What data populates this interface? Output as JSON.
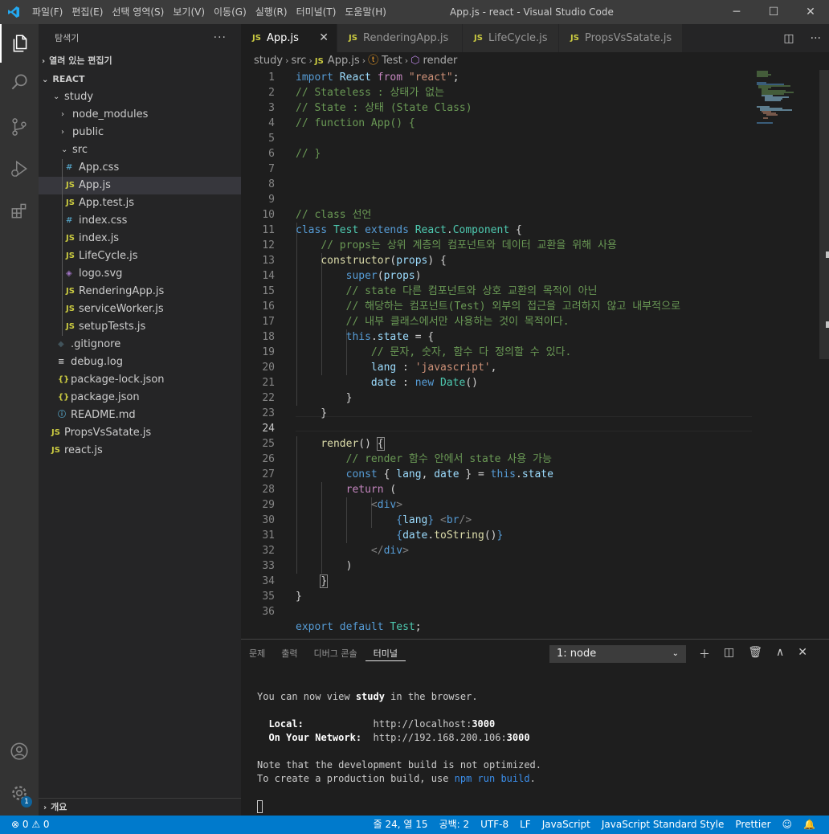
{
  "titlebar": {
    "menu": [
      "파일(F)",
      "편집(E)",
      "선택 영역(S)",
      "보기(V)",
      "이동(G)",
      "실행(R)",
      "터미널(T)",
      "도움말(H)"
    ],
    "title": "App.js - react - Visual Studio Code",
    "minimize": "─",
    "maximize": "☐",
    "close": "✕"
  },
  "sidebar": {
    "title": "탐색기",
    "more": "···",
    "open_editors": "열려 있는 편집기",
    "root": "REACT",
    "outline": "개요",
    "tree": [
      {
        "label": "study",
        "kind": "folder",
        "icon": "",
        "chev": "⌄"
      },
      {
        "label": "node_modules",
        "kind": "folder",
        "icon": "",
        "chev": "›"
      },
      {
        "label": "public",
        "kind": "folder",
        "icon": "",
        "chev": "›"
      },
      {
        "label": "src",
        "kind": "folder",
        "icon": "",
        "chev": "⌄"
      },
      {
        "label": "App.css",
        "kind": "css",
        "icon": "#"
      },
      {
        "label": "App.js",
        "kind": "js",
        "icon": "JS"
      },
      {
        "label": "App.test.js",
        "kind": "js",
        "icon": "JS"
      },
      {
        "label": "index.css",
        "kind": "css",
        "icon": "#"
      },
      {
        "label": "index.js",
        "kind": "js",
        "icon": "JS"
      },
      {
        "label": "LifeCycle.js",
        "kind": "js",
        "icon": "JS"
      },
      {
        "label": "logo.svg",
        "kind": "svg",
        "icon": "◈"
      },
      {
        "label": "RenderingApp.js",
        "kind": "js",
        "icon": "JS"
      },
      {
        "label": "serviceWorker.js",
        "kind": "js",
        "icon": "JS"
      },
      {
        "label": "setupTests.js",
        "kind": "js",
        "icon": "JS"
      },
      {
        "label": ".gitignore",
        "kind": "git",
        "icon": "◆"
      },
      {
        "label": "debug.log",
        "kind": "log",
        "icon": "≡"
      },
      {
        "label": "package-lock.json",
        "kind": "json",
        "icon": "{}"
      },
      {
        "label": "package.json",
        "kind": "json",
        "icon": "{}"
      },
      {
        "label": "README.md",
        "kind": "info",
        "icon": "ⓘ"
      },
      {
        "label": "PropsVsSatate.js",
        "kind": "js",
        "icon": "JS"
      },
      {
        "label": "react.js",
        "kind": "js",
        "icon": "JS"
      }
    ]
  },
  "tabs": [
    {
      "label": "App.js",
      "icon": "JS",
      "close": "✕"
    },
    {
      "label": "RenderingApp.js",
      "icon": "JS"
    },
    {
      "label": "LifeCycle.js",
      "icon": "JS"
    },
    {
      "label": "PropsVsSatate.js",
      "icon": "JS"
    }
  ],
  "breadcrumb": {
    "items": [
      "study",
      "src",
      "App.js",
      "Test",
      "render"
    ],
    "sep": "›",
    "js": "JS"
  },
  "editor": {
    "line_numbers": [
      "1",
      "2",
      "3",
      "4",
      "5",
      "6",
      "7",
      "8",
      "9",
      "10",
      "11",
      "12",
      "13",
      "14",
      "15",
      "16",
      "17",
      "18",
      "19",
      "20",
      "21",
      "22",
      "23",
      "24",
      "25",
      "26",
      "27",
      "28",
      "29",
      "30",
      "31",
      "32",
      "33",
      "34",
      "35",
      "36"
    ]
  },
  "panel": {
    "tabs": [
      "문제",
      "출력",
      "디버그 콘솔",
      "터미널"
    ],
    "terminal_select": "1: node",
    "dd": "⌄",
    "actions": [
      "＋",
      "◫",
      "🗑",
      "∧",
      "✕"
    ],
    "terminal": {
      "l1a": "You can now view ",
      "l1b": "study",
      "l1c": " in the browser.",
      "local_label": "  Local:",
      "local_url": "            http://localhost:",
      "local_port": "3000",
      "net_label": "  On Your Network:",
      "net_url": "  http://192.168.200.106:",
      "net_port": "3000",
      "n1": "Note that the development build is not optimized.",
      "n2a": "To create a production build, use ",
      "n2b": "npm run build",
      "n2c": "."
    }
  },
  "statusbar": {
    "errors": "⊗ 0 ⚠ 0",
    "position": "줄 24, 열 15",
    "spaces": "공백: 2",
    "encoding": "UTF-8",
    "eol": "LF",
    "language": "JavaScript",
    "linter": "JavaScript Standard Style",
    "prettier": "Prettier",
    "feedback": "☺",
    "bell": "🔔"
  },
  "activity": {
    "settings_badge": "1"
  },
  "colors": {
    "accent": "#007acc",
    "js": "#cbcb41",
    "css": "#519aba"
  }
}
